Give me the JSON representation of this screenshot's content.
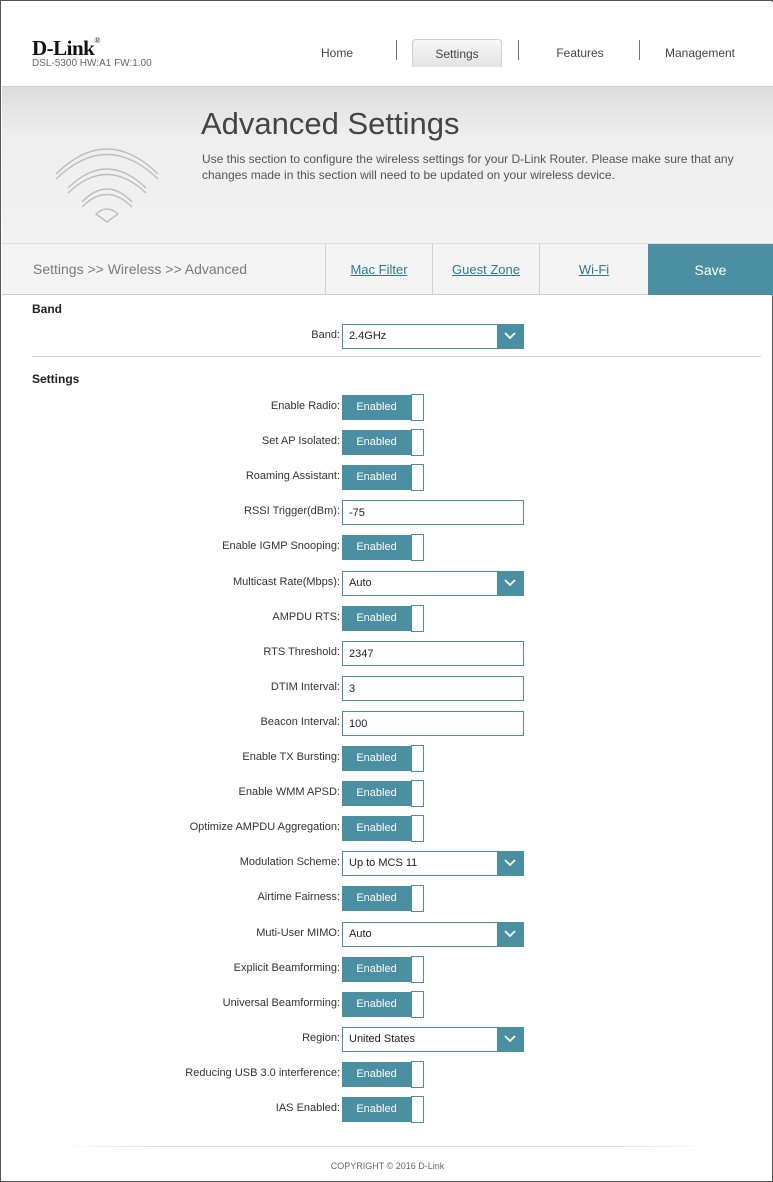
{
  "header": {
    "logo": "D-Link",
    "model": "DSL-5300 HW:A1 FW:1.00",
    "nav": [
      "Home",
      "Settings",
      "Features",
      "Management"
    ],
    "active_nav": "Settings"
  },
  "banner": {
    "title": "Advanced Settings",
    "description": "Use this section to configure the wireless settings for your D-Link Router. Please make sure that any changes made in this section will need to be updated on your wireless device.",
    "icon": "wifi-icon"
  },
  "subnav": {
    "breadcrumb": "Settings >> Wireless >> Advanced",
    "links": [
      "Mac Filter",
      "Guest Zone",
      "Wi-Fi"
    ],
    "save_label": "Save"
  },
  "band_section": {
    "title": "Band",
    "band_label": "Band:",
    "band_value": "2.4GHz"
  },
  "settings_section": {
    "title": "Settings",
    "rows": [
      {
        "label": "Enable Radio:",
        "type": "toggle",
        "value": "Enabled"
      },
      {
        "label": "Set AP Isolated:",
        "type": "toggle",
        "value": "Enabled"
      },
      {
        "label": "Roaming Assistant:",
        "type": "toggle",
        "value": "Enabled"
      },
      {
        "label": "RSSI Trigger(dBm):",
        "type": "input",
        "value": "-75"
      },
      {
        "label": "Enable IGMP Snooping:",
        "type": "toggle",
        "value": "Enabled"
      },
      {
        "label": "Multicast Rate(Mbps):",
        "type": "select",
        "value": "Auto"
      },
      {
        "label": "AMPDU RTS:",
        "type": "toggle",
        "value": "Enabled"
      },
      {
        "label": "RTS Threshold:",
        "type": "input",
        "value": "2347"
      },
      {
        "label": "DTIM Interval:",
        "type": "input",
        "value": "3"
      },
      {
        "label": "Beacon Interval:",
        "type": "input",
        "value": "100"
      },
      {
        "label": "Enable TX Bursting:",
        "type": "toggle",
        "value": "Enabled"
      },
      {
        "label": "Enable WMM APSD:",
        "type": "toggle",
        "value": "Enabled"
      },
      {
        "label": "Optimize AMPDU Aggregation:",
        "type": "toggle",
        "value": "Enabled"
      },
      {
        "label": "Modulation Scheme:",
        "type": "select",
        "value": "Up to MCS 11"
      },
      {
        "label": "Airtime Fairness:",
        "type": "toggle",
        "value": "Enabled"
      },
      {
        "label": "Muti-User MIMO:",
        "type": "select",
        "value": "Auto"
      },
      {
        "label": "Explicit Beamforming:",
        "type": "toggle",
        "value": "Enabled"
      },
      {
        "label": "Universal Beamforming:",
        "type": "toggle",
        "value": "Enabled"
      },
      {
        "label": "Region:",
        "type": "select",
        "value": "United States"
      },
      {
        "label": "Reducing USB 3.0 interference:",
        "type": "toggle",
        "value": "Enabled"
      },
      {
        "label": "IAS Enabled:",
        "type": "toggle",
        "value": "Enabled"
      }
    ]
  },
  "footer": {
    "copyright": "COPYRIGHT © 2016 D-Link"
  },
  "colors": {
    "accent": "#4b8fa3",
    "link": "#2a7b8c"
  }
}
